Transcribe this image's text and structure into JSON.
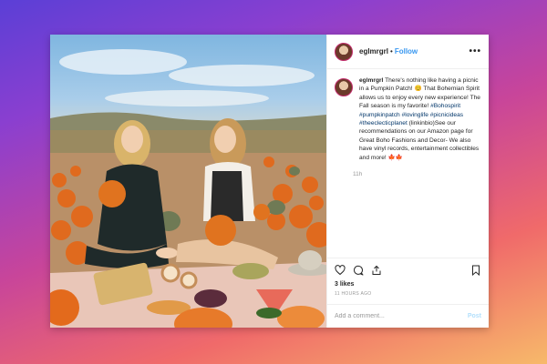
{
  "post": {
    "username": "eglmrgrl",
    "follow_label": "Follow",
    "dot": "•",
    "more_label": "•••",
    "caption_user": "eglmrgrl",
    "caption_parts": [
      {
        "text": " There's nothing like having a picnic in a Pumpkin Patch! 😊 That Bohemian Spirit allows us to enjoy every new experience! The Fall season is my favorite! ",
        "tag": false
      },
      {
        "text": "#Bohospirit",
        "tag": true
      },
      {
        "text": " ",
        "tag": false
      },
      {
        "text": "#pumpkinpatch",
        "tag": true
      },
      {
        "text": " ",
        "tag": false
      },
      {
        "text": "#lovinglife",
        "tag": true
      },
      {
        "text": " ",
        "tag": false
      },
      {
        "text": "#picnicideas",
        "tag": true
      },
      {
        "text": " ",
        "tag": false
      },
      {
        "text": "#theeclecticplanet",
        "tag": true
      },
      {
        "text": " (linkinbio)See our recommendations on our Amazon page for Great Boho Fashions and Decor- We also have vinyl records, entertainment collectibles and more! 🍁🍁",
        "tag": false
      }
    ],
    "caption_time": "11h",
    "likes": "3 likes",
    "time_ago": "11 HOURS AGO",
    "comment_placeholder": "Add a comment...",
    "post_button": "Post"
  },
  "colors": {
    "link_blue": "#3897f0",
    "hashtag": "#003569",
    "post_button": "#b2dffc"
  },
  "icons": {
    "heart": "heart-icon",
    "comment": "comment-icon",
    "share": "share-icon",
    "bookmark": "bookmark-icon"
  }
}
